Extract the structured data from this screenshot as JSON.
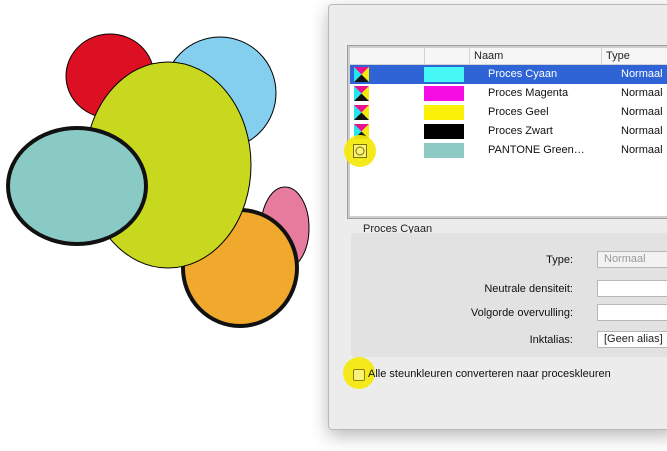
{
  "colors": {
    "selection_blue": "#2e64d6",
    "highlight_yellow": "#f4ea10",
    "red_circle": "#dc0f23",
    "blue_circle": "#84cfee",
    "lime_circle": "#c8d81e",
    "teal_circle": "#8acac4",
    "pink_circle": "#e77b9d",
    "orange_circle": "#f0a82d"
  },
  "ink_list": {
    "headers": {
      "swatch": "",
      "name": "Naam",
      "type": "Type"
    },
    "rows": [
      {
        "name": "Proces Cyaan",
        "type": "Normaal",
        "swatch": "#45f7f5",
        "icon": "process-ink-icon",
        "selected": true
      },
      {
        "name": "Proces Magenta",
        "type": "Normaal",
        "swatch": "#f50de4",
        "icon": "process-ink-icon",
        "selected": false
      },
      {
        "name": "Proces Geel",
        "type": "Normaal",
        "swatch": "#fbf106",
        "icon": "process-ink-icon",
        "selected": false
      },
      {
        "name": "Proces Zwart",
        "type": "Normaal",
        "swatch": "#000000",
        "icon": "process-ink-icon",
        "selected": false
      },
      {
        "name": "PANTONE Green…",
        "type": "Normaal",
        "swatch": "#8ccac3",
        "icon": "spot-ink-icon",
        "selected": false
      }
    ]
  },
  "details": {
    "title": "Proces Cyaan",
    "type_label": "Type:",
    "type_value": "Normaal",
    "density_label": "Neutrale densiteit:",
    "density_value": "",
    "sequence_label": "Volgorde overvulling:",
    "sequence_value": "",
    "alias_label": "Inktalias:",
    "alias_value": "[Geen alias]"
  },
  "convert_checkbox": {
    "label": "Alle steunkleuren converteren naar proceskleuren",
    "checked": false
  }
}
